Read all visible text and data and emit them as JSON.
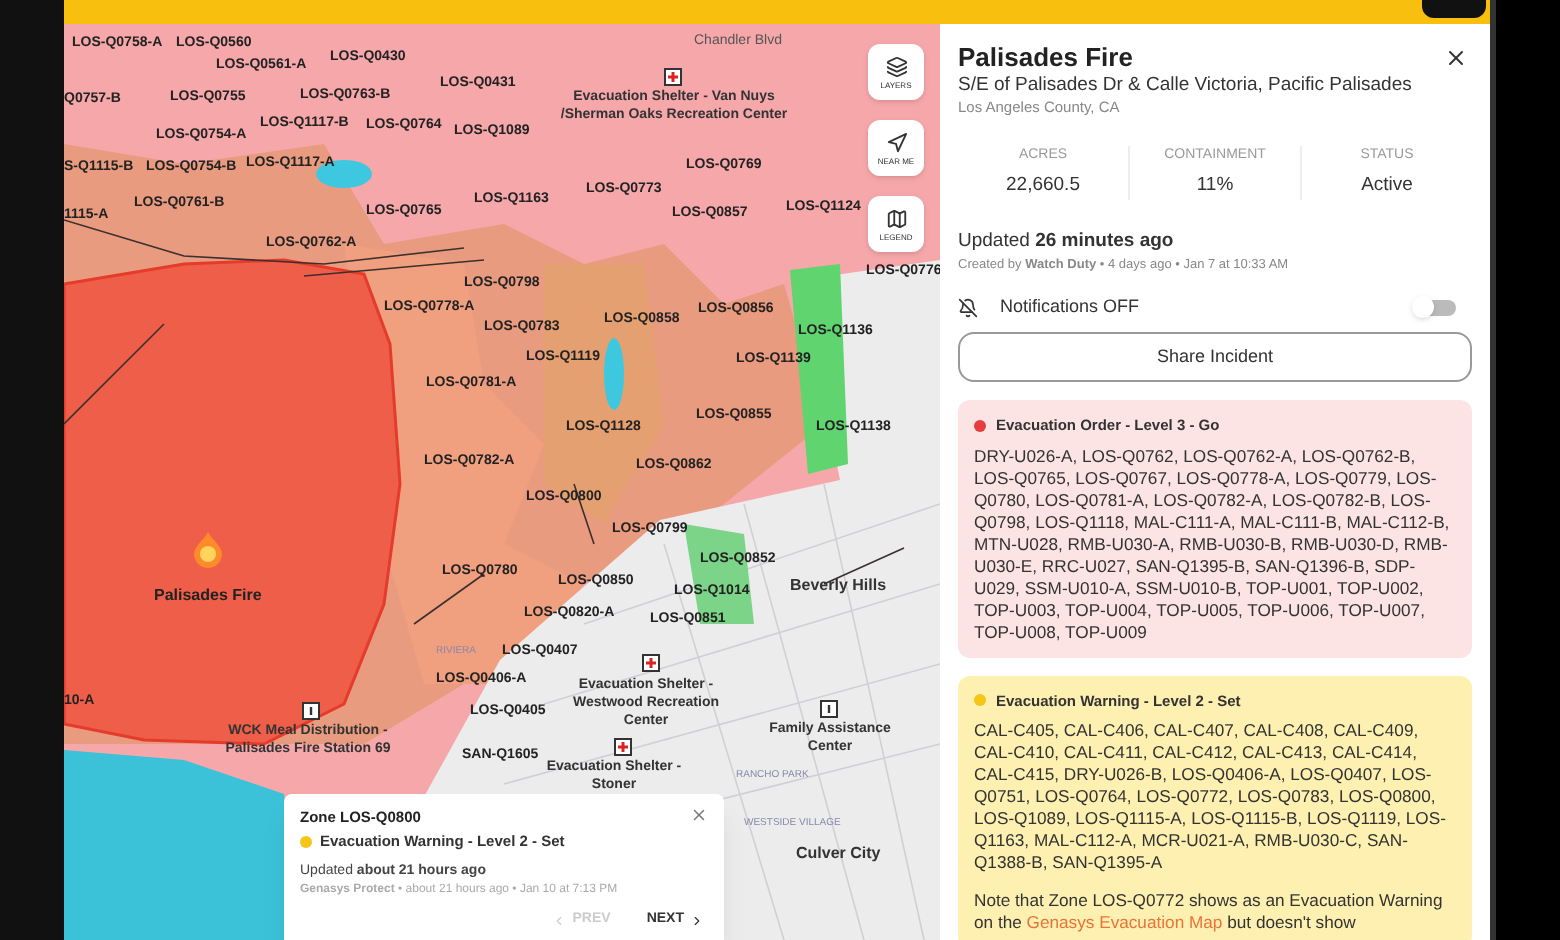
{
  "map": {
    "road_labels": [
      "Chandler Blvd"
    ],
    "zone_labels": [
      "LOS-Q0758-A",
      "LOS-Q0560",
      "LOS-Q0561-A",
      "LOS-Q0430",
      "LOS-Q0431",
      "Q0757-B",
      "LOS-Q0755",
      "LOS-Q0763-B",
      "LOS-Q0754-A",
      "LOS-Q1117-B",
      "LOS-Q0764",
      "LOS-Q1089",
      "S-Q1115-B",
      "LOS-Q0754-B",
      "LOS-Q1117-A",
      "LOS-Q0761-B",
      "1115-A",
      "LOS-Q0765",
      "LOS-Q1163",
      "LOS-Q0773",
      "LOS-Q0769",
      "LOS-Q0857",
      "LOS-Q1124",
      "LOS-Q0762-A",
      "LOS-Q0776",
      "LOS-Q0798",
      "LOS-Q0778-A",
      "LOS-Q0783",
      "LOS-Q0858",
      "LOS-Q0856",
      "LOS-Q1136",
      "LOS-Q1119",
      "LOS-Q1139",
      "LOS-Q0781-A",
      "LOS-Q1128",
      "LOS-Q0855",
      "LOS-Q1138",
      "LOS-Q0782-A",
      "LOS-Q0862",
      "LOS-Q0800",
      "LOS-Q0799",
      "LOS-Q0852",
      "LOS-Q0780",
      "LOS-Q0850",
      "LOS-Q1014",
      "LOS-Q0820-A",
      "LOS-Q0851",
      "LOS-Q0407",
      "LOS-Q0406-A",
      "LOS-Q0405",
      "SAN-Q1605",
      "10-A"
    ],
    "city_labels": [
      "Beverly Hills",
      "Culver City"
    ],
    "neighborhood_labels": [
      "RIVIERA",
      "RANCHO PARK",
      "WESTSIDE VILLAGE"
    ],
    "pois": [
      {
        "kind": "shelter",
        "name": "Evacuation Shelter - Van Nuys /Sherman Oaks Recreation Center"
      },
      {
        "kind": "info",
        "name": "WCK Meal Distribution - Palisades Fire Station 69"
      },
      {
        "kind": "shelter",
        "name": "Evacuation Shelter - Westwood Recreation Center"
      },
      {
        "kind": "info",
        "name": "Family Assistance Center"
      },
      {
        "kind": "shelter",
        "name": "Evacuation Shelter - Stoner"
      }
    ],
    "fire": {
      "name": "Palisades Fire"
    },
    "controls": [
      {
        "kind": "layers",
        "label": "LAYERS"
      },
      {
        "kind": "near",
        "label": "NEAR ME"
      },
      {
        "kind": "legend",
        "label": "LEGEND"
      }
    ],
    "popup": {
      "title": "Zone LOS-Q0800",
      "status": "Evacuation Warning - Level 2 - Set",
      "color": "#f5c518",
      "updated": "Updated **about 21 hours ago**",
      "source": "**Genasys Protect** • about 21 hours ago • Jan 10 at 7:13 PM",
      "prev": {
        "label": "PREV",
        "disabled": true
      },
      "next": {
        "label": "NEXT",
        "disabled": false
      }
    }
  },
  "panel": {
    "title": "Palisades Fire",
    "location": "S/E of Palisades Dr & Calle Victoria, Pacific Palisades",
    "county": "Los Angeles County, CA",
    "stats": [
      {
        "label": "ACRES",
        "value": "22,660.5"
      },
      {
        "label": "CONTAINMENT",
        "value": "11%"
      },
      {
        "label": "STATUS",
        "value": "Active"
      }
    ],
    "updated": "Updated **26 minutes ago**",
    "created": "Created by **Watch Duty** • 4 days ago • Jan 7 at 10:33 AM",
    "notifications": {
      "label": "Notifications OFF",
      "on": false
    },
    "share_button": "Share Incident",
    "alerts": [
      {
        "title": "Evacuation Order - Level 3 - Go",
        "color": "#e53e3e",
        "zones": "DRY-U026-A, LOS-Q0762, LOS-Q0762-A, LOS-Q0762-B, LOS-Q0765, LOS-Q0767, LOS-Q0778-A, LOS-Q0779, LOS-Q0780, LOS-Q0781-A, LOS-Q0782-A, LOS-Q0782-B, LOS-Q0798, LOS-Q1118, MAL-C111-A, MAL-C111-B, MAL-C112-B, MTN-U028, RMB-U030-A, RMB-U030-B, RMB-U030-D, RMB-U030-E, RRC-U027, SAN-Q1395-B, SAN-Q1396-B, SDP-U029, SSM-U010-A, SSM-U010-B, TOP-U001, TOP-U002, TOP-U003, TOP-U004, TOP-U005, TOP-U006, TOP-U007, TOP-U008, TOP-U009"
      },
      {
        "title": "Evacuation Warning - Level 2 - Set",
        "color": "#f5c518",
        "zones": "CAL-C405, CAL-C406, CAL-C407, CAL-C408, CAL-C409, CAL-C410, CAL-C411, CAL-C412, CAL-C413, CAL-C414, CAL-C415, DRY-U026-B, LOS-Q0406-A, LOS-Q0407, LOS-Q0751, LOS-Q0764, LOS-Q0772, LOS-Q0783, LOS-Q0800, LOS-Q1089, LOS-Q1115-A, LOS-Q1115-B, LOS-Q1119, LOS-Q1163, MAL-C112-A, MCR-U021-A, RMB-U030-C, SAN-Q1388-B, SAN-Q1395-A",
        "note": {
          "before": "Note that Zone LOS-Q0772 shows as an Evacuation Warning on the ",
          "link": "Genasys Evacuation Map",
          "after": " but doesn't show"
        }
      }
    ]
  }
}
